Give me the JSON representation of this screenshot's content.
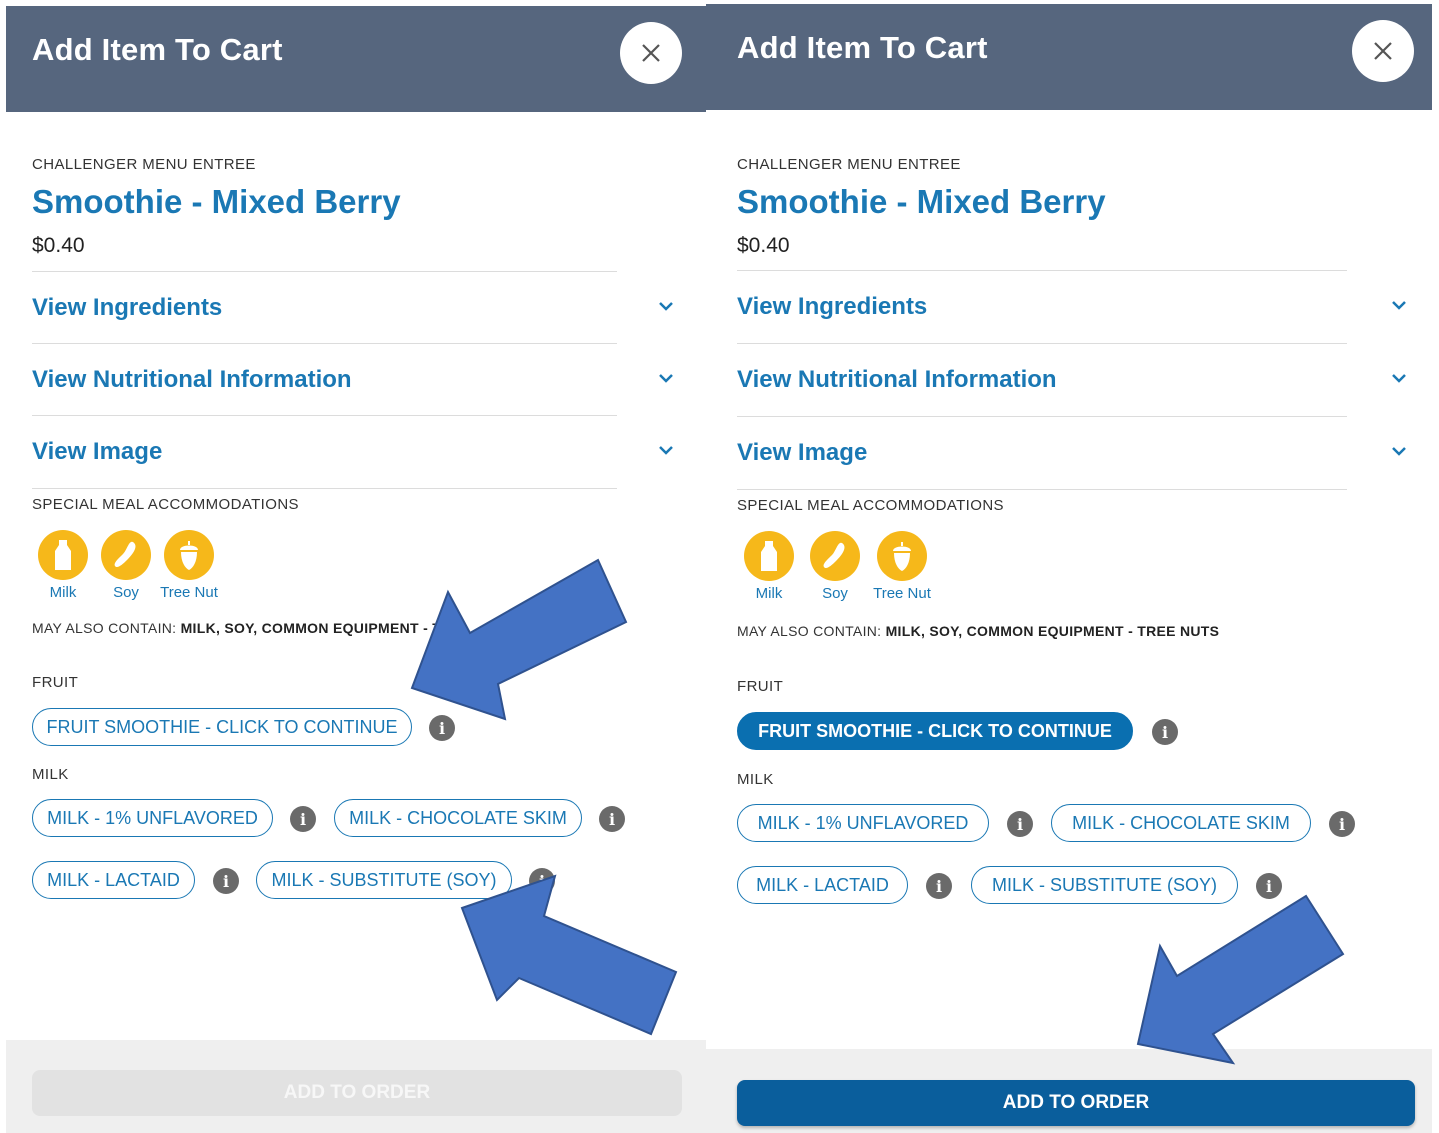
{
  "colors": {
    "header_bg": "#56667e",
    "accent_blue": "#1a78b4",
    "selected_blue": "#0a6fb0",
    "order_button_active": "#0a5e9c",
    "order_button_disabled": "#e2e2e2",
    "allergen_badge": "#f6b81a",
    "annotation_arrow": "#4472c4"
  },
  "panels": [
    {
      "state": "before",
      "header": {
        "title": "Add Item To Cart",
        "close_icon": "close-icon"
      },
      "item": {
        "category": "CHALLENGER MENU ENTREE",
        "title": "Smoothie - Mixed Berry",
        "price": "$0.40"
      },
      "accordions": [
        {
          "label": "View Ingredients",
          "icon": "chevron-down-icon"
        },
        {
          "label": "View Nutritional Information",
          "icon": "chevron-down-icon"
        },
        {
          "label": "View Image",
          "icon": "chevron-down-icon"
        }
      ],
      "accommodations": {
        "label": "SPECIAL MEAL ACCOMMODATIONS",
        "allergens": [
          {
            "label": "Milk",
            "icon": "milk-bottle-icon"
          },
          {
            "label": "Soy",
            "icon": "soybean-icon"
          },
          {
            "label": "Tree Nut",
            "icon": "acorn-icon"
          }
        ]
      },
      "may_contain": {
        "prefix": "MAY ALSO CONTAIN:",
        "visible_text": "MILK, SOY, COMMON EQUIPMENT - T"
      },
      "fruit": {
        "label": "FRUIT",
        "options": [
          {
            "label": "FRUIT SMOOTHIE - CLICK TO CONTINUE",
            "selected": false
          }
        ]
      },
      "milk": {
        "label": "MILK",
        "options": [
          {
            "label": "MILK - 1% UNFLAVORED",
            "selected": false
          },
          {
            "label": "MILK - CHOCOLATE SKIM",
            "selected": false
          },
          {
            "label": "MILK - LACTAID",
            "selected": false
          },
          {
            "label": "MILK - SUBSTITUTE (SOY)",
            "selected": false
          }
        ]
      },
      "footer": {
        "order_label": "ADD TO ORDER",
        "enabled": false
      }
    },
    {
      "state": "after",
      "header": {
        "title": "Add Item To Cart",
        "close_icon": "close-icon"
      },
      "item": {
        "category": "CHALLENGER MENU ENTREE",
        "title": "Smoothie - Mixed Berry",
        "price": "$0.40"
      },
      "accordions": [
        {
          "label": "View Ingredients",
          "icon": "chevron-down-icon"
        },
        {
          "label": "View Nutritional Information",
          "icon": "chevron-down-icon"
        },
        {
          "label": "View Image",
          "icon": "chevron-down-icon"
        }
      ],
      "accommodations": {
        "label": "SPECIAL MEAL ACCOMMODATIONS",
        "allergens": [
          {
            "label": "Milk",
            "icon": "milk-bottle-icon"
          },
          {
            "label": "Soy",
            "icon": "soybean-icon"
          },
          {
            "label": "Tree Nut",
            "icon": "acorn-icon"
          }
        ]
      },
      "may_contain": {
        "prefix": "MAY ALSO CONTAIN:",
        "visible_text": "MILK, SOY, COMMON EQUIPMENT - TREE NUTS"
      },
      "fruit": {
        "label": "FRUIT",
        "options": [
          {
            "label": "FRUIT SMOOTHIE - CLICK TO CONTINUE",
            "selected": true
          }
        ]
      },
      "milk": {
        "label": "MILK",
        "options": [
          {
            "label": "MILK - 1% UNFLAVORED",
            "selected": false
          },
          {
            "label": "MILK - CHOCOLATE SKIM",
            "selected": false
          },
          {
            "label": "MILK - LACTAID",
            "selected": false
          },
          {
            "label": "MILK - SUBSTITUTE (SOY)",
            "selected": false
          }
        ]
      },
      "footer": {
        "order_label": "ADD TO ORDER",
        "enabled": true
      }
    }
  ],
  "info_icon": "info-icon"
}
